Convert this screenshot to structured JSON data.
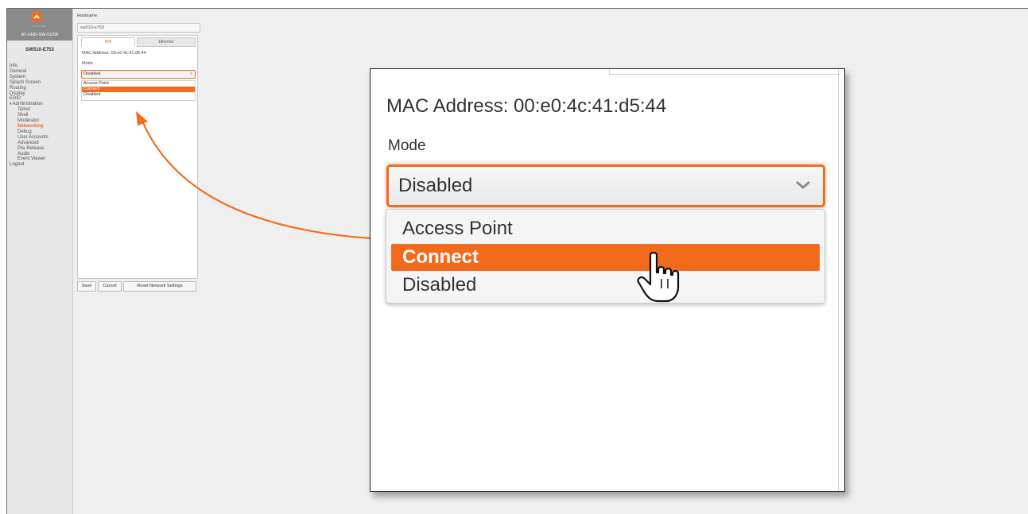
{
  "app": {
    "model": "AT-UHD-SW-510W",
    "logo_text": "ATLONA",
    "device_name": "SW510-E753",
    "accent_color": "#f26b1d"
  },
  "sidebar": {
    "items": [
      {
        "label": "Info",
        "sub": false
      },
      {
        "label": "General",
        "sub": false
      },
      {
        "label": "System",
        "sub": false
      },
      {
        "label": "Splash Screen",
        "sub": false
      },
      {
        "label": "Routing",
        "sub": false
      },
      {
        "label": "Display",
        "sub": false
      },
      {
        "label": "EDID",
        "sub": false
      },
      {
        "label": "Administration",
        "sub": false,
        "expanded": true
      },
      {
        "label": "Telnet",
        "sub": true
      },
      {
        "label": "Shell",
        "sub": true
      },
      {
        "label": "Moderator",
        "sub": true
      },
      {
        "label": "Networking",
        "sub": true,
        "active": true
      },
      {
        "label": "Debug",
        "sub": true
      },
      {
        "label": "User Accounts",
        "sub": true
      },
      {
        "label": "Advanced",
        "sub": true
      },
      {
        "label": "Pre-Release",
        "sub": true
      },
      {
        "label": "Audio",
        "sub": true
      },
      {
        "label": "Event Viewer",
        "sub": true
      },
      {
        "label": "Logout",
        "sub": false
      }
    ]
  },
  "panel": {
    "hostname_label": "Hostname",
    "hostname_value": "sw510-e753",
    "tabs": [
      {
        "label": "Wifi",
        "active": true
      },
      {
        "label": "Ethernet",
        "active": false
      }
    ],
    "mac_address": "MAC Address: 00:e0:4c:41:d5:44",
    "mode_label": "Mode",
    "mode_value": "Disabled",
    "mode_options": [
      "Access Point",
      "Connect",
      "Disabled"
    ],
    "highlighted_option": "Connect",
    "buttons": {
      "save": "Save",
      "cancel": "Cancel",
      "reset": "Reset Network Settings"
    }
  },
  "icons": {
    "logo": "atlona-chevron-icon",
    "select_chevron": "chevron-down-icon",
    "cursor": "hand-pointer-icon",
    "callout_arrow": "callout-arrow-icon"
  }
}
